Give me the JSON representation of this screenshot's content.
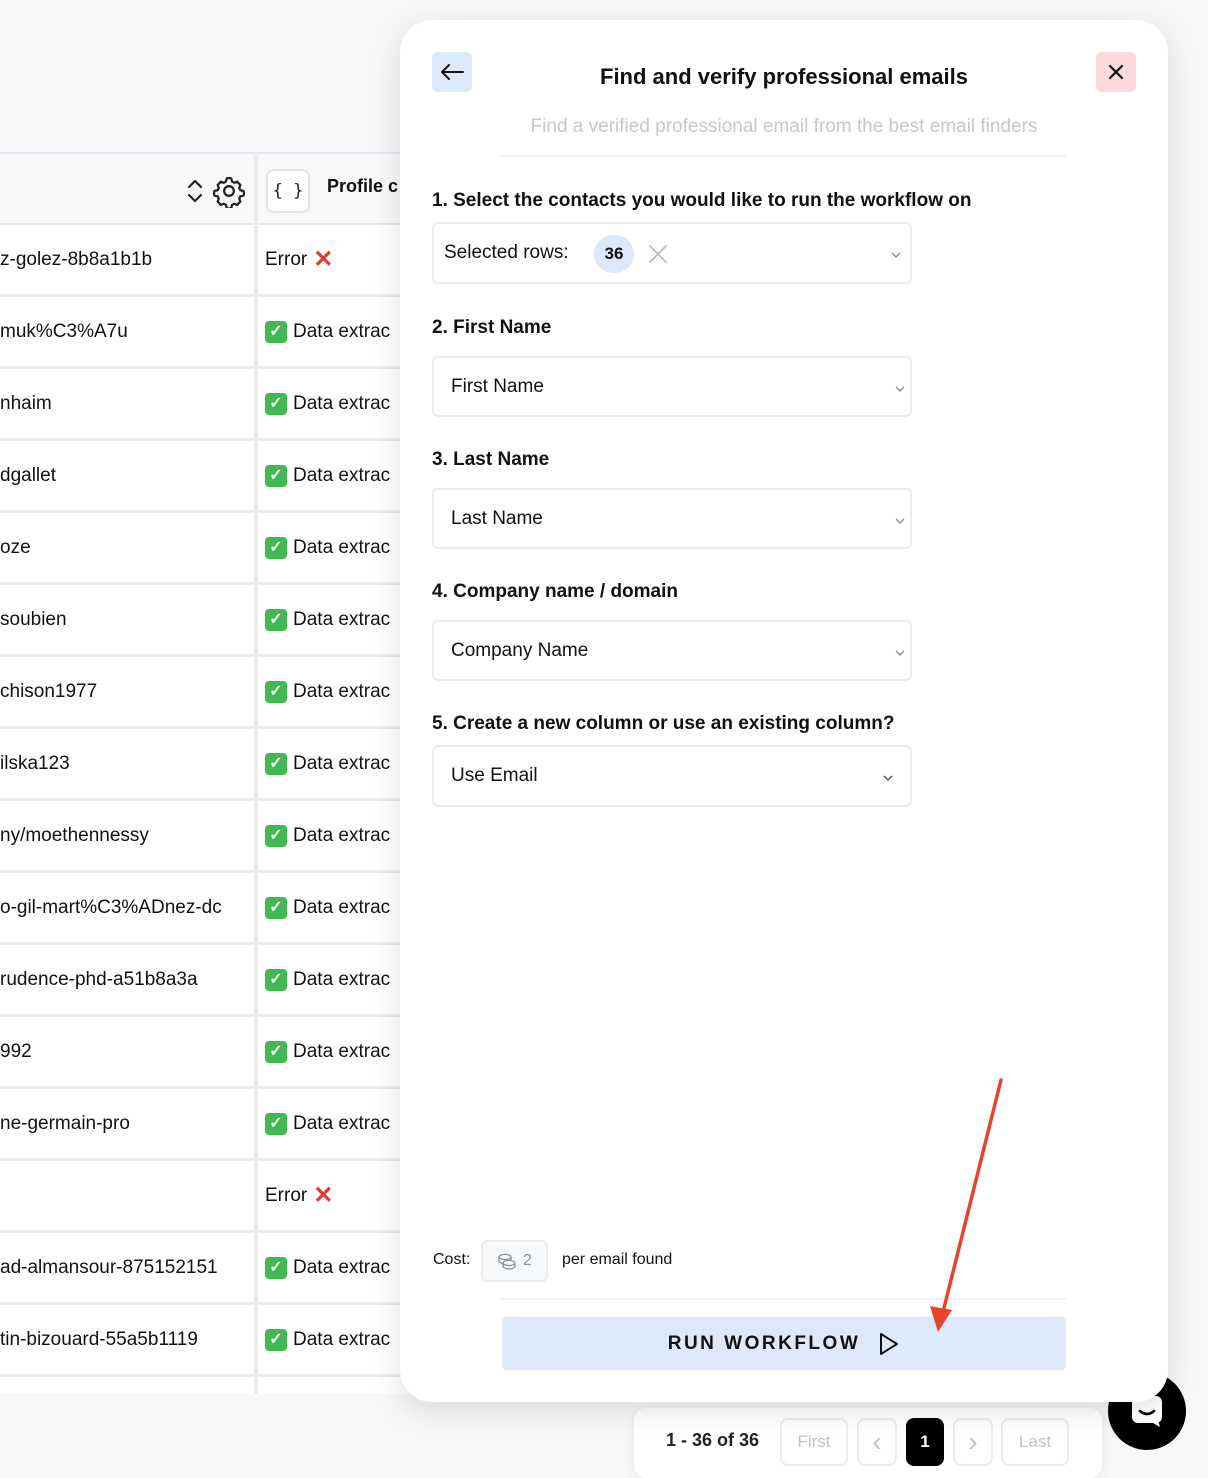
{
  "table": {
    "profile_header": "Profile c",
    "json_button": "{ }",
    "rows": [
      {
        "slug": "z-golez-8b8a1b1b",
        "status": "Error",
        "status_type": "error"
      },
      {
        "slug": "muk%C3%A7u",
        "status": "Data extrac",
        "status_type": "ok"
      },
      {
        "slug": "nhaim",
        "status": "Data extrac",
        "status_type": "ok"
      },
      {
        "slug": "dgallet",
        "status": "Data extrac",
        "status_type": "ok"
      },
      {
        "slug": "oze",
        "status": "Data extrac",
        "status_type": "ok"
      },
      {
        "slug": "soubien",
        "status": "Data extrac",
        "status_type": "ok"
      },
      {
        "slug": "chison1977",
        "status": "Data extrac",
        "status_type": "ok"
      },
      {
        "slug": "ilska123",
        "status": "Data extrac",
        "status_type": "ok"
      },
      {
        "slug": "ny/moethennessy",
        "status": "Data extrac",
        "status_type": "ok"
      },
      {
        "slug": "o-gil-mart%C3%ADnez-dc",
        "status": "Data extrac",
        "status_type": "ok"
      },
      {
        "slug": "rudence-phd-a51b8a3a",
        "status": "Data extrac",
        "status_type": "ok"
      },
      {
        "slug": "992",
        "status": "Data extrac",
        "status_type": "ok"
      },
      {
        "slug": "ne-germain-pro",
        "status": "Data extrac",
        "status_type": "ok"
      },
      {
        "slug": "",
        "status": "Error",
        "status_type": "error"
      },
      {
        "slug": "ad-almansour-875152151",
        "status": "Data extrac",
        "status_type": "ok"
      },
      {
        "slug": "tin-bizouard-55a5b1119",
        "status": "Data extrac",
        "status_type": "ok"
      }
    ]
  },
  "pagination": {
    "range": "1 - 36 of 36",
    "first": "First",
    "prev": "‹",
    "current": "1",
    "next": "›",
    "last": "Last"
  },
  "modal": {
    "title": "Find and verify professional emails",
    "subtitle": "Find a verified professional email from the best email finders",
    "steps": {
      "contacts_label": "1. Select the contacts you would like to run the workflow on",
      "contacts_value": "Selected rows:",
      "contacts_count": "36",
      "first_name_label": "2. First Name",
      "first_name_value": "First Name",
      "last_name_label": "3. Last Name",
      "last_name_value": "Last Name",
      "company_label": "4. Company name / domain",
      "company_value": "Company Name",
      "column_label": "5. Create a new column or use an existing column?",
      "column_value": "Use Email"
    },
    "cost": {
      "label": "Cost:",
      "value": "2",
      "suffix": "per email found"
    },
    "run_button": "RUN WORKFLOW"
  },
  "colors": {
    "accent_light_blue": "#dce9fb",
    "close_pink": "#fbd9dd",
    "error_red": "#e53a2c",
    "success_green": "#3fb950",
    "annotation_arrow": "#e8432c"
  }
}
